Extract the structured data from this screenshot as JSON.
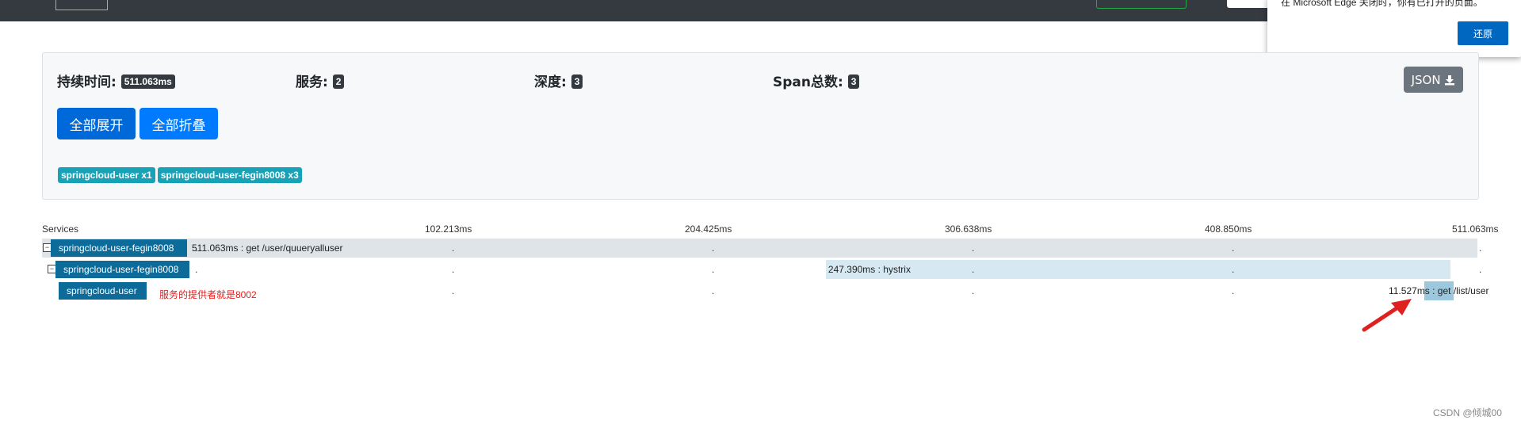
{
  "browser_popup": {
    "message": "在 Microsoft Edge 关闭时，你有已打开的页面。",
    "restore_label": "还原"
  },
  "summary": {
    "duration_label": "持续时间:",
    "duration_value": "511.063ms",
    "services_label": "服务:",
    "services_value": "2",
    "depth_label": "深度:",
    "depth_value": "3",
    "span_count_label": "Span总数:",
    "span_count_value": "3",
    "json_label": "JSON",
    "expand_all_label": "全部展开",
    "collapse_all_label": "全部折叠",
    "service_tags": [
      "springcloud-user x1",
      "springcloud-user-fegin8008 x3"
    ]
  },
  "timeline": {
    "services_header": "Services",
    "ticks": [
      "102.213ms",
      "204.425ms",
      "306.638ms",
      "408.850ms",
      "511.063ms"
    ],
    "spans": [
      {
        "service": "springcloud-user-fegin8008",
        "label": "511.063ms : get /user/quueryalluser",
        "start_ms": 0,
        "duration_ms": 511.063
      },
      {
        "service": "springcloud-user-fegin8008",
        "label": "247.390ms : hystrix",
        "start_ms": 253.0,
        "duration_ms": 247.39
      },
      {
        "service": "springcloud-user",
        "label_value": "11.527",
        "label_rest": "ms : get /list/user",
        "start_ms": 490.0,
        "duration_ms": 11.527
      }
    ],
    "annotation": "服务的提供者就是8002"
  },
  "colors": {
    "service_bar": "#0d6b9a",
    "tag": "#17a2b8",
    "annotation": "#e0201f",
    "arrow": "#e0201f"
  },
  "watermark": "CSDN @倾城00"
}
